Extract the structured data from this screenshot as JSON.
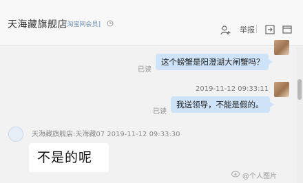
{
  "header": {
    "shop_name": "天海藏旗舰店",
    "shop_tag": "[淘宝网会员]",
    "report_label": "举报"
  },
  "icons": {
    "clock": "clock-icon",
    "user_add": "user-add-icon",
    "collapse": "collapse-icon",
    "window": "window-icon"
  },
  "messages": [
    {
      "text": "这个螃蟹是阳澄湖大闸蟹吗？",
      "status": "已读"
    },
    {
      "time": "2019-11-12 09:33:11",
      "text": "我送领导，不能是假的。",
      "status": "已读"
    }
  ],
  "seller": {
    "meta": "天海藏旗舰店:天海藏07   2019-11-12 09:33:30",
    "text": "不是的呢"
  },
  "watermark": "@个人图片",
  "colors": {
    "bubble": "#cfe3f8",
    "background": "#f2f2f2"
  }
}
